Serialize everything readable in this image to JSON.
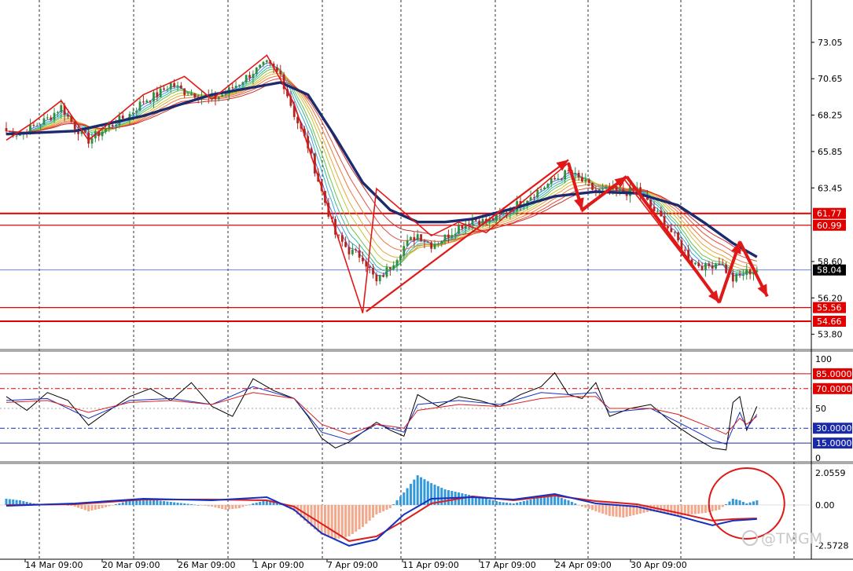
{
  "watermark": "@TMGM",
  "colors": {
    "up_candle": "#2f8f3e",
    "down_candle": "#b3261e",
    "level_line": "#e00000",
    "current_line": "#3355dd",
    "slow_ma": "#1c2a6e",
    "blue_level": "#1a2aa8",
    "hist_pos": "#3399dd",
    "hist_neg": "#f2a88a",
    "signal_red": "#d92020",
    "signal_blue": "#1530c0",
    "arrow": "#e01818",
    "ribbon": [
      "#4b6fd8",
      "#3aa6d6",
      "#39b89a",
      "#6cc24a",
      "#c8c43a",
      "#e9a53a",
      "#ec7a3a",
      "#e34f3a",
      "#c8302c"
    ]
  },
  "chart_data": [
    {
      "type": "candlestick",
      "panel": "price",
      "x_labels": [
        "14 Mar 09:00",
        "20 Mar 09:00",
        "26 Mar 09:00",
        "1 Apr 09:00",
        "7 Apr 09:00",
        "11 Apr 09:00",
        "17 Apr 09:00",
        "24 Apr 09:00",
        "30 Apr 09:00"
      ],
      "y_ticks": [
        73.05,
        70.65,
        68.25,
        65.85,
        63.45,
        58.6,
        56.2,
        53.8
      ],
      "ylim": [
        52.9,
        74.7
      ],
      "grid": true,
      "current_price": 58.04,
      "horizontal_levels": [
        61.77,
        60.99,
        55.56,
        54.66
      ],
      "close_path": [
        [
          0,
          67.2
        ],
        [
          4,
          67.0
        ],
        [
          8,
          67.5
        ],
        [
          12,
          68.0
        ],
        [
          16,
          68.8
        ],
        [
          20,
          67.5
        ],
        [
          24,
          66.6
        ],
        [
          28,
          67.2
        ],
        [
          32,
          67.8
        ],
        [
          36,
          68.3
        ],
        [
          40,
          69.2
        ],
        [
          44,
          69.6
        ],
        [
          48,
          70.3
        ],
        [
          52,
          69.8
        ],
        [
          56,
          69.6
        ],
        [
          60,
          69.3
        ],
        [
          64,
          69.7
        ],
        [
          68,
          70.4
        ],
        [
          72,
          71.1
        ],
        [
          76,
          71.6
        ],
        [
          80,
          70.9
        ],
        [
          84,
          68.3
        ],
        [
          88,
          66.2
        ],
        [
          92,
          63.2
        ],
        [
          96,
          60.4
        ],
        [
          100,
          59.3
        ],
        [
          104,
          58.9
        ],
        [
          108,
          57.2
        ],
        [
          112,
          58.3
        ],
        [
          116,
          59.6
        ],
        [
          120,
          60.4
        ],
        [
          124,
          59.7
        ],
        [
          128,
          60.2
        ],
        [
          132,
          60.9
        ],
        [
          136,
          61.4
        ],
        [
          140,
          61.2
        ],
        [
          144,
          61.6
        ],
        [
          148,
          62.2
        ],
        [
          152,
          62.8
        ],
        [
          156,
          63.4
        ],
        [
          160,
          64.0
        ],
        [
          164,
          64.5
        ],
        [
          168,
          63.9
        ],
        [
          172,
          63.2
        ],
        [
          176,
          63.3
        ],
        [
          180,
          63.1
        ],
        [
          184,
          63.4
        ],
        [
          188,
          62.2
        ],
        [
          192,
          61.2
        ],
        [
          196,
          59.9
        ],
        [
          200,
          58.6
        ],
        [
          204,
          58.2
        ],
        [
          208,
          58.6
        ],
        [
          212,
          57.4
        ],
        [
          216,
          57.9
        ],
        [
          219,
          58.04
        ]
      ],
      "series": [
        {
          "name": "",
          "role": "slow_ma",
          "values": [
            [
              0,
              67.0
            ],
            [
              20,
              67.2
            ],
            [
              40,
              68.2
            ],
            [
              60,
              69.6
            ],
            [
              80,
              70.4
            ],
            [
              88,
              69.6
            ],
            [
              96,
              66.8
            ],
            [
              104,
              63.8
            ],
            [
              112,
              62.0
            ],
            [
              120,
              61.2
            ],
            [
              128,
              61.2
            ],
            [
              136,
              61.4
            ],
            [
              148,
              62.1
            ],
            [
              160,
              62.9
            ],
            [
              172,
              63.2
            ],
            [
              184,
              63.1
            ],
            [
              196,
              62.3
            ],
            [
              204,
              61.1
            ],
            [
              212,
              59.8
            ],
            [
              219,
              58.9
            ]
          ]
        }
      ]
    },
    {
      "type": "line",
      "panel": "oscillator_1",
      "y_ticks": [
        100,
        50,
        0
      ],
      "ylim": [
        0,
        100
      ],
      "levels": [
        85.0,
        70.0,
        30.0,
        15.0
      ],
      "level_labels": [
        "85.0000",
        "70.0000",
        "30.0000",
        "15.0000"
      ],
      "series": [
        {
          "name": "",
          "color": "#000000",
          "values": [
            [
              0,
              62
            ],
            [
              6,
              48
            ],
            [
              12,
              66
            ],
            [
              18,
              58
            ],
            [
              24,
              33
            ],
            [
              30,
              48
            ],
            [
              36,
              62
            ],
            [
              42,
              70
            ],
            [
              48,
              58
            ],
            [
              54,
              76
            ],
            [
              60,
              52
            ],
            [
              66,
              42
            ],
            [
              72,
              80
            ],
            [
              78,
              68
            ],
            [
              84,
              60
            ],
            [
              88,
              42
            ],
            [
              92,
              20
            ],
            [
              96,
              10
            ],
            [
              100,
              16
            ],
            [
              104,
              26
            ],
            [
              108,
              36
            ],
            [
              112,
              28
            ],
            [
              116,
              22
            ],
            [
              120,
              64
            ],
            [
              126,
              52
            ],
            [
              132,
              62
            ],
            [
              138,
              58
            ],
            [
              144,
              52
            ],
            [
              150,
              64
            ],
            [
              156,
              72
            ],
            [
              160,
              86
            ],
            [
              164,
              64
            ],
            [
              168,
              60
            ],
            [
              172,
              76
            ],
            [
              176,
              42
            ],
            [
              182,
              50
            ],
            [
              188,
              54
            ],
            [
              194,
              36
            ],
            [
              200,
              22
            ],
            [
              206,
              10
            ],
            [
              210,
              8
            ],
            [
              212,
              56
            ],
            [
              214,
              62
            ],
            [
              216,
              28
            ],
            [
              219,
              52
            ]
          ]
        },
        {
          "name": "",
          "color": "#1530c0",
          "values": [
            [
              0,
              58
            ],
            [
              12,
              60
            ],
            [
              24,
              40
            ],
            [
              36,
              58
            ],
            [
              48,
              60
            ],
            [
              60,
              54
            ],
            [
              72,
              72
            ],
            [
              84,
              60
            ],
            [
              92,
              26
            ],
            [
              100,
              18
            ],
            [
              108,
              34
            ],
            [
              116,
              26
            ],
            [
              120,
              54
            ],
            [
              132,
              58
            ],
            [
              144,
              54
            ],
            [
              156,
              66
            ],
            [
              164,
              64
            ],
            [
              172,
              66
            ],
            [
              176,
              46
            ],
            [
              188,
              50
            ],
            [
              196,
              36
            ],
            [
              206,
              18
            ],
            [
              210,
              14
            ],
            [
              214,
              46
            ],
            [
              216,
              30
            ],
            [
              219,
              44
            ]
          ]
        },
        {
          "name": "",
          "color": "#d92020",
          "values": [
            [
              0,
              56
            ],
            [
              12,
              58
            ],
            [
              24,
              46
            ],
            [
              36,
              56
            ],
            [
              48,
              58
            ],
            [
              60,
              54
            ],
            [
              72,
              66
            ],
            [
              84,
              60
            ],
            [
              92,
              34
            ],
            [
              100,
              24
            ],
            [
              108,
              34
            ],
            [
              116,
              30
            ],
            [
              120,
              48
            ],
            [
              132,
              54
            ],
            [
              144,
              52
            ],
            [
              156,
              60
            ],
            [
              164,
              62
            ],
            [
              172,
              62
            ],
            [
              176,
              50
            ],
            [
              188,
              50
            ],
            [
              196,
              44
            ],
            [
              206,
              30
            ],
            [
              210,
              24
            ],
            [
              214,
              40
            ],
            [
              216,
              34
            ],
            [
              219,
              42
            ]
          ]
        }
      ]
    },
    {
      "type": "bar",
      "panel": "oscillator_2",
      "y_ticks": [
        2.0559,
        0.0,
        -2.5728
      ],
      "y_tick_labels": [
        "2.0559",
        "0.00",
        "-2.5728"
      ],
      "ylim": [
        -2.5728,
        2.0559
      ],
      "histogram": [
        [
          0,
          0.4
        ],
        [
          4,
          0.3
        ],
        [
          8,
          0.1
        ],
        [
          12,
          0.05
        ],
        [
          16,
          0.1
        ],
        [
          20,
          -0.1
        ],
        [
          24,
          -0.4
        ],
        [
          28,
          -0.2
        ],
        [
          32,
          0.05
        ],
        [
          36,
          0.3
        ],
        [
          40,
          0.4
        ],
        [
          44,
          0.3
        ],
        [
          48,
          0.2
        ],
        [
          52,
          0.1
        ],
        [
          56,
          0.0
        ],
        [
          60,
          -0.1
        ],
        [
          64,
          -0.3
        ],
        [
          68,
          -0.2
        ],
        [
          72,
          0.1
        ],
        [
          76,
          0.3
        ],
        [
          80,
          0.1
        ],
        [
          84,
          -0.4
        ],
        [
          88,
          -1.2
        ],
        [
          92,
          -1.9
        ],
        [
          96,
          -2.2
        ],
        [
          100,
          -2.0
        ],
        [
          104,
          -1.4
        ],
        [
          108,
          -0.6
        ],
        [
          112,
          -0.2
        ],
        [
          116,
          0.8
        ],
        [
          120,
          1.9
        ],
        [
          124,
          1.4
        ],
        [
          128,
          1.0
        ],
        [
          132,
          0.8
        ],
        [
          136,
          0.6
        ],
        [
          140,
          0.4
        ],
        [
          144,
          0.2
        ],
        [
          148,
          0.1
        ],
        [
          152,
          0.3
        ],
        [
          156,
          0.5
        ],
        [
          160,
          0.6
        ],
        [
          164,
          0.3
        ],
        [
          168,
          -0.1
        ],
        [
          172,
          -0.4
        ],
        [
          176,
          -0.7
        ],
        [
          180,
          -0.8
        ],
        [
          184,
          -0.6
        ],
        [
          188,
          -0.4
        ],
        [
          192,
          -0.5
        ],
        [
          196,
          -0.7
        ],
        [
          200,
          -0.6
        ],
        [
          204,
          -0.5
        ],
        [
          208,
          -0.3
        ],
        [
          212,
          0.4
        ],
        [
          214,
          0.3
        ],
        [
          216,
          0.1
        ],
        [
          219,
          0.3
        ]
      ],
      "series": [
        {
          "name": "",
          "color": "#d92020",
          "values": [
            [
              0,
              0.0
            ],
            [
              20,
              0.05
            ],
            [
              40,
              0.35
            ],
            [
              60,
              0.35
            ],
            [
              76,
              0.3
            ],
            [
              84,
              -0.1
            ],
            [
              92,
              -1.2
            ],
            [
              100,
              -2.3
            ],
            [
              108,
              -2.0
            ],
            [
              116,
              -1.0
            ],
            [
              124,
              0.1
            ],
            [
              136,
              0.55
            ],
            [
              148,
              0.3
            ],
            [
              160,
              0.6
            ],
            [
              172,
              0.25
            ],
            [
              184,
              0.05
            ],
            [
              196,
              -0.5
            ],
            [
              206,
              -1.0
            ],
            [
              212,
              -0.9
            ],
            [
              219,
              -0.85
            ]
          ]
        },
        {
          "name": "",
          "color": "#1530c0",
          "values": [
            [
              0,
              -0.05
            ],
            [
              20,
              0.1
            ],
            [
              40,
              0.4
            ],
            [
              60,
              0.3
            ],
            [
              76,
              0.5
            ],
            [
              84,
              -0.3
            ],
            [
              92,
              -1.8
            ],
            [
              100,
              -2.6
            ],
            [
              108,
              -2.2
            ],
            [
              116,
              -0.6
            ],
            [
              124,
              0.4
            ],
            [
              136,
              0.5
            ],
            [
              148,
              0.35
            ],
            [
              160,
              0.7
            ],
            [
              172,
              0.1
            ],
            [
              184,
              -0.1
            ],
            [
              196,
              -0.7
            ],
            [
              206,
              -1.3
            ],
            [
              212,
              -1.0
            ],
            [
              219,
              -0.9
            ]
          ]
        }
      ]
    }
  ],
  "annotations": {
    "zigzag_main": [
      [
        0,
        66.6
      ],
      [
        8,
        67.8
      ],
      [
        16,
        69.2
      ],
      [
        24,
        66.6
      ],
      [
        40,
        69.6
      ],
      [
        52,
        70.8
      ],
      [
        60,
        69.3
      ],
      [
        76,
        72.2
      ],
      [
        84,
        69.0
      ],
      [
        104,
        55.2
      ],
      [
        108,
        63.4
      ],
      [
        124,
        60.3
      ],
      [
        132,
        61.2
      ],
      [
        140,
        60.5
      ],
      [
        164,
        65.1
      ],
      [
        168,
        61.9
      ],
      [
        180,
        64.1
      ],
      [
        208,
        55.9
      ],
      [
        214,
        59.9
      ],
      [
        219,
        57.6
      ]
    ],
    "arrows": [
      [
        105,
        55.3,
        164,
        65.3
      ],
      [
        164,
        65.1,
        168,
        62.0
      ],
      [
        168,
        62.0,
        181,
        64.2
      ],
      [
        181,
        64.2,
        208,
        55.9
      ],
      [
        208,
        55.9,
        214,
        59.9
      ],
      [
        214,
        59.9,
        222,
        56.3
      ]
    ],
    "circle_center": [
      216,
      0.1
    ]
  }
}
